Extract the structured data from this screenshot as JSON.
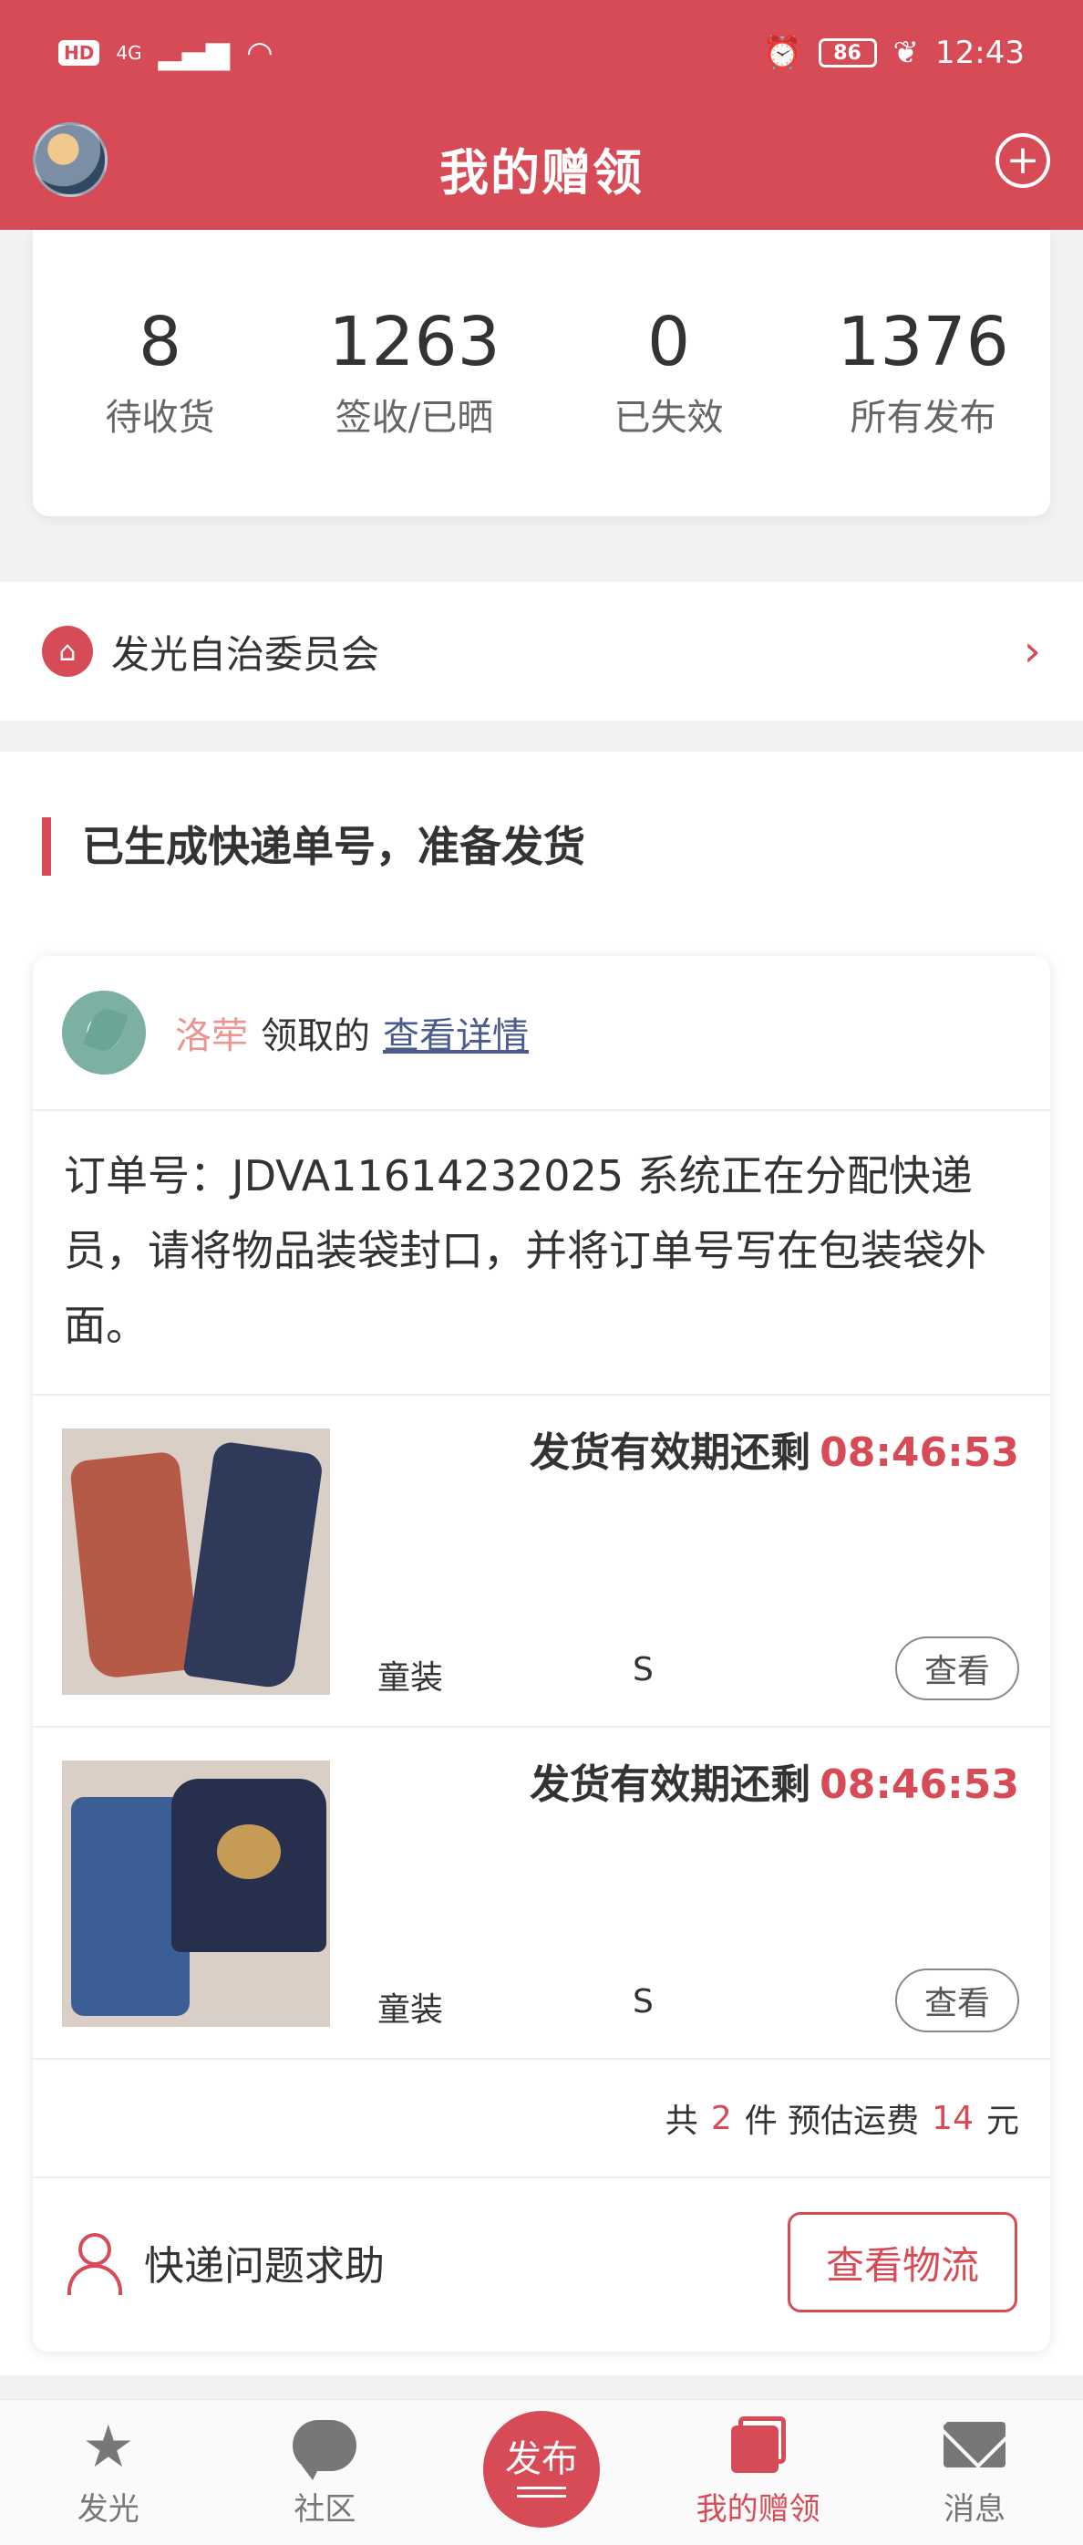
{
  "statusbar": {
    "network_badge": "HD",
    "network_type": "4G",
    "battery": "86",
    "time": "12:43"
  },
  "header": {
    "title": "我的赠领"
  },
  "stats": [
    {
      "value": "8",
      "label": "待收货"
    },
    {
      "value": "1263",
      "label": "签收/已晒"
    },
    {
      "value": "0",
      "label": "已失效"
    },
    {
      "value": "1376",
      "label": "所有发布"
    }
  ],
  "community": {
    "label": "发光自治委员会"
  },
  "section": {
    "title": "已生成快递单号，准备发货"
  },
  "order": {
    "giver_name": "洛荦",
    "giver_text": "领取的",
    "detail_link": "查看详情",
    "description": "订单号：JDVA11614232025 系统正在分配快递员，请将物品装袋封口，并将订单号写在包装袋外面。",
    "items": [
      {
        "countdown_label": "发货有效期还剩",
        "countdown_time": "08:46:53",
        "category": "童装",
        "size": "S",
        "view_label": "查看"
      },
      {
        "countdown_label": "发货有效期还剩",
        "countdown_time": "08:46:53",
        "category": "童装",
        "size": "S",
        "view_label": "查看"
      }
    ],
    "summary": {
      "prefix": "共",
      "count": "2",
      "middle": "件 预估运费",
      "fee": "14",
      "suffix": "元"
    },
    "help_label": "快递问题求助",
    "track_label": "查看物流"
  },
  "tabbar": [
    {
      "label": "发光",
      "icon": "star-icon"
    },
    {
      "label": "社区",
      "icon": "chat-bubble-icon"
    },
    {
      "label": "发布",
      "icon": "publish-icon"
    },
    {
      "label": "我的赠领",
      "icon": "books-icon",
      "active": true
    },
    {
      "label": "消息",
      "icon": "envelope-icon"
    }
  ],
  "colors": {
    "brand": "#d64b56",
    "giver_name": "#e8968f",
    "link": "#4a5b8c"
  }
}
